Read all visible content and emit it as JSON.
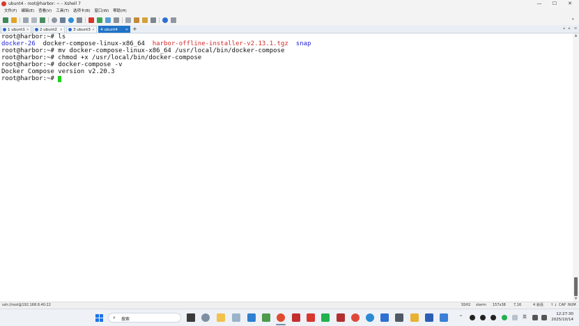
{
  "window": {
    "title": "ubunt4 - root@harbor: ~ - Xshell 7",
    "controls": {
      "minimize": "—",
      "maximize": "☐",
      "close": "✕"
    }
  },
  "menu": [
    "文件(F)",
    "编辑(E)",
    "查看(V)",
    "工具(T)",
    "选项卡(B)",
    "窗口(W)",
    "帮助(H)"
  ],
  "tabs": [
    {
      "label": "1 ubunt1"
    },
    {
      "label": "2 ubunt2"
    },
    {
      "label": "3 ubunt3"
    },
    {
      "label": "4 ubunt4",
      "active": true
    }
  ],
  "tab_add": "+",
  "terminal": {
    "lines": [
      [
        {
          "t": "root@harbor:~# ls"
        }
      ],
      [
        {
          "t": "docker-26",
          "c": "blue"
        },
        {
          "t": "  docker-compose-linux-x86_64  "
        },
        {
          "t": "harbor-offline-installer-v2.13.1.tgz",
          "c": "red"
        },
        {
          "t": "  "
        },
        {
          "t": "snap",
          "c": "blue"
        }
      ],
      [
        {
          "t": "root@harbor:~# mv docker-compose-linux-x86_64 /usr/local/bin/docker-compose"
        }
      ],
      [
        {
          "t": "root@harbor:~# chmod +x /usr/local/bin/docker-compose"
        }
      ],
      [
        {
          "t": "root@harbor:~# docker-compose -v"
        }
      ],
      [
        {
          "t": "Docker Compose version v2.20.3"
        }
      ],
      [
        {
          "t": "root@harbor:~# "
        }
      ]
    ]
  },
  "statusbar": {
    "connection": "ssh://root@192.168.8.40:22",
    "protocol": "SSH2",
    "terminal_type": "xterm",
    "size": "157x38",
    "cursor_pos": "7,16",
    "sessions": "4 会话",
    "caps": "CAP",
    "num": "NUM"
  },
  "taskbar": {
    "search_placeholder": "搜索",
    "tray_lang": "英",
    "time": "12:27:30",
    "date": "2025/10/14"
  },
  "colors": {
    "active_tab": "#1f73c9",
    "dir_blue": "#2222d6",
    "archive_red": "#d42a2a",
    "cursor_green": "#1fd21f"
  }
}
